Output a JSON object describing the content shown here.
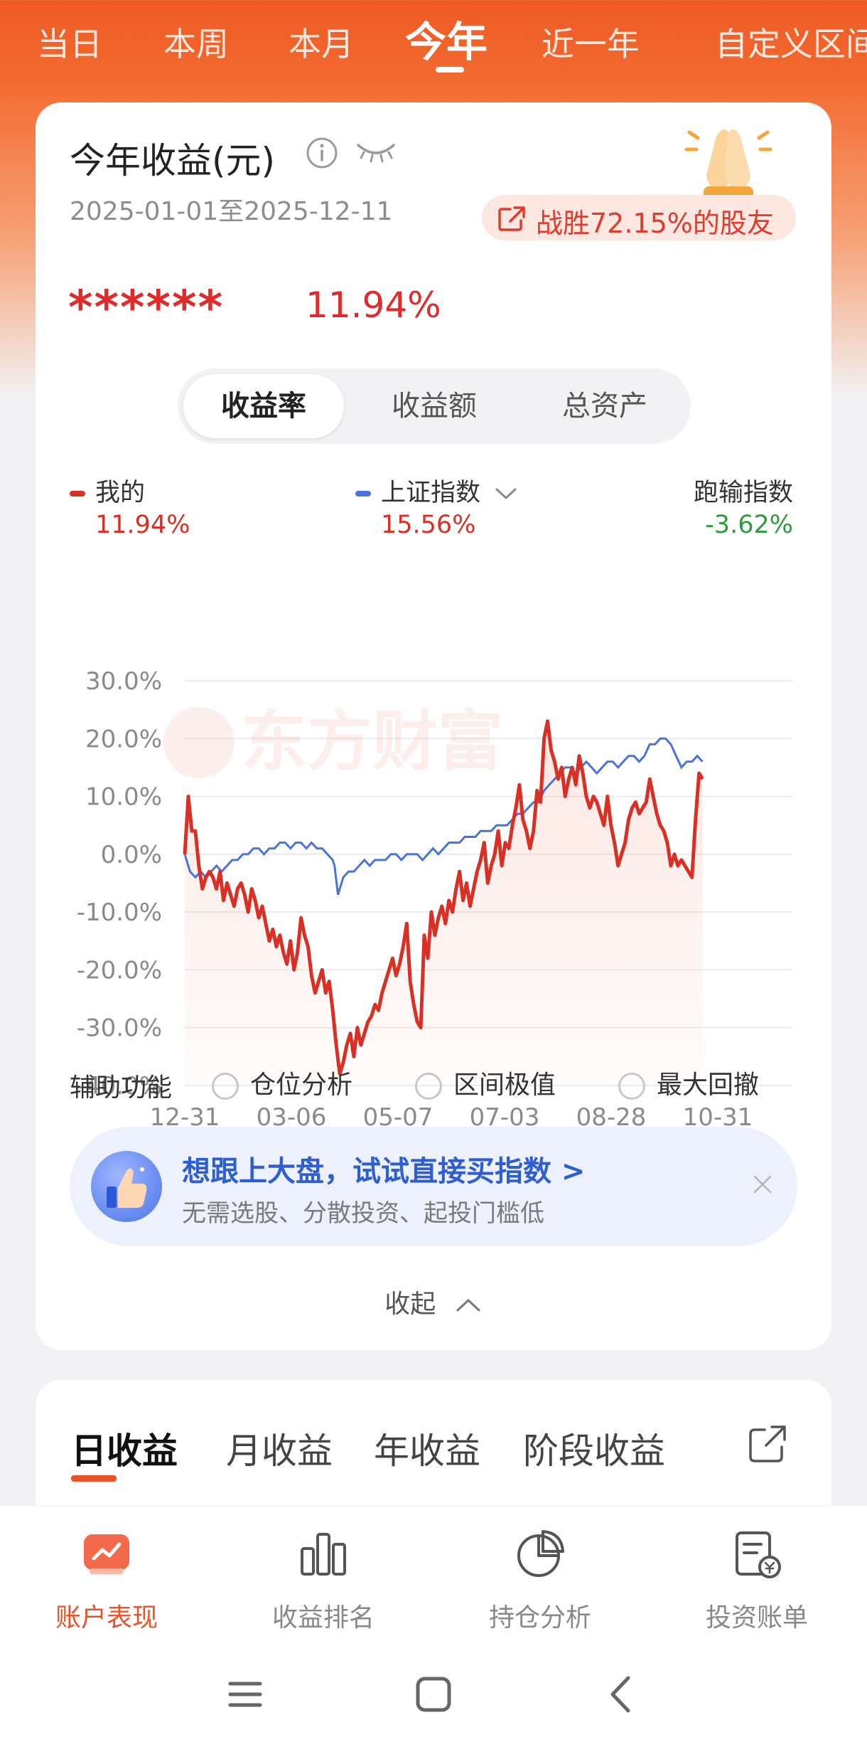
{
  "period_tabs": [
    {
      "label": "当日"
    },
    {
      "label": "本周"
    },
    {
      "label": "本月"
    },
    {
      "label": "今年"
    },
    {
      "label": "近一年"
    },
    {
      "label": "自定义区间"
    }
  ],
  "summary": {
    "title": "今年收益(元)",
    "date_range": "2025-01-01至2025-12-11",
    "beat_text": "战胜72.15%的股友",
    "masked_amount": "******",
    "return_pct": "11.94%"
  },
  "segments": [
    {
      "label": "收益率"
    },
    {
      "label": "收益额"
    },
    {
      "label": "总资产"
    }
  ],
  "legend": {
    "mine": {
      "name": "我的",
      "value": "11.94%"
    },
    "index": {
      "name": "上证指数",
      "value": "15.56%"
    },
    "diff": {
      "name": "跑输指数",
      "value": "-3.62%"
    }
  },
  "colors": {
    "accent": "#e8532a",
    "mine": "#d93025",
    "index": "#4a73d9",
    "negative": "#2e9b3b"
  },
  "watermark": "东方财富",
  "chart_data": {
    "type": "line",
    "x_ticks": [
      "12-31",
      "03-06",
      "05-07",
      "07-03",
      "08-28",
      "10-31"
    ],
    "y_ticks": [
      "30.0%",
      "20.0%",
      "10.0%",
      "0.0%",
      "-10.0%",
      "-20.0%",
      "-30.0%",
      "-40.0%"
    ],
    "ylim": [
      -40,
      30
    ],
    "x_range": [
      0,
      345
    ],
    "series": [
      {
        "name": "我的",
        "color": "#d93025",
        "points": [
          [
            0,
            0
          ],
          [
            2,
            10
          ],
          [
            4,
            4
          ],
          [
            6,
            4
          ],
          [
            8,
            -2
          ],
          [
            10,
            -6
          ],
          [
            12,
            -4
          ],
          [
            14,
            -3
          ],
          [
            16,
            -4
          ],
          [
            18,
            -6
          ],
          [
            20,
            -3
          ],
          [
            22,
            -8
          ],
          [
            24,
            -5
          ],
          [
            26,
            -7
          ],
          [
            28,
            -9
          ],
          [
            30,
            -6
          ],
          [
            32,
            -5
          ],
          [
            34,
            -7
          ],
          [
            36,
            -10
          ],
          [
            38,
            -6
          ],
          [
            40,
            -8
          ],
          [
            42,
            -11
          ],
          [
            44,
            -9
          ],
          [
            46,
            -12
          ],
          [
            48,
            -15
          ],
          [
            50,
            -13
          ],
          [
            52,
            -16
          ],
          [
            54,
            -14
          ],
          [
            56,
            -17
          ],
          [
            58,
            -19
          ],
          [
            60,
            -15
          ],
          [
            62,
            -20
          ],
          [
            64,
            -17
          ],
          [
            66,
            -11
          ],
          [
            68,
            -14
          ],
          [
            70,
            -16
          ],
          [
            72,
            -21
          ],
          [
            74,
            -24
          ],
          [
            76,
            -22
          ],
          [
            78,
            -20
          ],
          [
            80,
            -24
          ],
          [
            82,
            -22
          ],
          [
            84,
            -27
          ],
          [
            86,
            -33
          ],
          [
            88,
            -38
          ],
          [
            90,
            -36
          ],
          [
            92,
            -33
          ],
          [
            94,
            -31
          ],
          [
            96,
            -35
          ],
          [
            98,
            -30
          ],
          [
            100,
            -33
          ],
          [
            102,
            -31
          ],
          [
            104,
            -29
          ],
          [
            106,
            -28
          ],
          [
            108,
            -26
          ],
          [
            110,
            -27
          ],
          [
            112,
            -24
          ],
          [
            114,
            -22
          ],
          [
            116,
            -20
          ],
          [
            118,
            -18
          ],
          [
            120,
            -21
          ],
          [
            122,
            -19
          ],
          [
            124,
            -16
          ],
          [
            126,
            -12
          ],
          [
            128,
            -22
          ],
          [
            130,
            -26
          ],
          [
            132,
            -29
          ],
          [
            134,
            -30
          ],
          [
            136,
            -14
          ],
          [
            138,
            -18
          ],
          [
            140,
            -10
          ],
          [
            142,
            -14
          ],
          [
            144,
            -11
          ],
          [
            146,
            -9
          ],
          [
            148,
            -12
          ],
          [
            150,
            -8
          ],
          [
            152,
            -10
          ],
          [
            154,
            -6
          ],
          [
            156,
            -3
          ],
          [
            158,
            -8
          ],
          [
            160,
            -5
          ],
          [
            162,
            -9
          ],
          [
            164,
            -6
          ],
          [
            166,
            -3
          ],
          [
            168,
            -1
          ],
          [
            170,
            2
          ],
          [
            172,
            -5
          ],
          [
            174,
            -2
          ],
          [
            176,
            0
          ],
          [
            178,
            4
          ],
          [
            180,
            -2
          ],
          [
            182,
            2
          ],
          [
            184,
            1
          ],
          [
            186,
            5
          ],
          [
            188,
            8
          ],
          [
            190,
            12
          ],
          [
            192,
            6
          ],
          [
            194,
            4
          ],
          [
            196,
            1
          ],
          [
            198,
            4
          ],
          [
            200,
            11
          ],
          [
            202,
            9
          ],
          [
            204,
            20
          ],
          [
            206,
            23
          ],
          [
            208,
            18
          ],
          [
            210,
            16
          ],
          [
            212,
            13
          ],
          [
            214,
            15
          ],
          [
            216,
            10
          ],
          [
            218,
            13
          ],
          [
            220,
            15
          ],
          [
            222,
            12
          ],
          [
            224,
            17
          ],
          [
            226,
            14
          ],
          [
            228,
            10
          ],
          [
            230,
            8
          ],
          [
            232,
            10
          ],
          [
            234,
            9
          ],
          [
            236,
            7
          ],
          [
            238,
            5
          ],
          [
            240,
            10
          ],
          [
            242,
            5
          ],
          [
            244,
            2
          ],
          [
            246,
            -2
          ],
          [
            248,
            0
          ],
          [
            250,
            2
          ],
          [
            252,
            6
          ],
          [
            254,
            8
          ],
          [
            256,
            9
          ],
          [
            258,
            7
          ],
          [
            260,
            8
          ],
          [
            262,
            9
          ],
          [
            264,
            13
          ],
          [
            266,
            10
          ],
          [
            268,
            7
          ],
          [
            270,
            5
          ],
          [
            272,
            4
          ],
          [
            274,
            2
          ],
          [
            276,
            -2
          ],
          [
            278,
            0
          ],
          [
            280,
            -2
          ],
          [
            282,
            -1
          ],
          [
            284,
            -2
          ],
          [
            286,
            -3
          ],
          [
            288,
            -4
          ],
          [
            290,
            6
          ],
          [
            292,
            14
          ],
          [
            294,
            13
          ]
        ]
      },
      {
        "name": "上证指数",
        "color": "#4a73d9",
        "points": [
          [
            0,
            0
          ],
          [
            3,
            -3
          ],
          [
            6,
            -4
          ],
          [
            9,
            -3
          ],
          [
            12,
            -4
          ],
          [
            15,
            -3
          ],
          [
            18,
            -2
          ],
          [
            21,
            -3
          ],
          [
            24,
            -2
          ],
          [
            27,
            -1
          ],
          [
            30,
            -1
          ],
          [
            33,
            0
          ],
          [
            36,
            0
          ],
          [
            39,
            1
          ],
          [
            42,
            1
          ],
          [
            45,
            0
          ],
          [
            48,
            1
          ],
          [
            51,
            1
          ],
          [
            54,
            2
          ],
          [
            57,
            2
          ],
          [
            60,
            1
          ],
          [
            63,
            2
          ],
          [
            66,
            2
          ],
          [
            69,
            1
          ],
          [
            72,
            2
          ],
          [
            75,
            1
          ],
          [
            78,
            1
          ],
          [
            81,
            0
          ],
          [
            84,
            -1
          ],
          [
            85,
            -2
          ],
          [
            87,
            -7
          ],
          [
            90,
            -4
          ],
          [
            93,
            -3
          ],
          [
            96,
            -3
          ],
          [
            99,
            -2
          ],
          [
            102,
            -1
          ],
          [
            105,
            -2
          ],
          [
            108,
            -1
          ],
          [
            111,
            -1
          ],
          [
            114,
            -1
          ],
          [
            117,
            0
          ],
          [
            120,
            0
          ],
          [
            123,
            -1
          ],
          [
            126,
            0
          ],
          [
            129,
            0
          ],
          [
            132,
            0
          ],
          [
            135,
            -1
          ],
          [
            138,
            0
          ],
          [
            141,
            1
          ],
          [
            144,
            0
          ],
          [
            147,
            1
          ],
          [
            150,
            2
          ],
          [
            153,
            2
          ],
          [
            156,
            2
          ],
          [
            159,
            3
          ],
          [
            162,
            3
          ],
          [
            165,
            3
          ],
          [
            168,
            4
          ],
          [
            171,
            4
          ],
          [
            174,
            4
          ],
          [
            177,
            5
          ],
          [
            180,
            5
          ],
          [
            183,
            5
          ],
          [
            186,
            6
          ],
          [
            189,
            7
          ],
          [
            192,
            7
          ],
          [
            195,
            8
          ],
          [
            198,
            9
          ],
          [
            201,
            9
          ],
          [
            204,
            11
          ],
          [
            207,
            12
          ],
          [
            210,
            13
          ],
          [
            213,
            14
          ],
          [
            216,
            15
          ],
          [
            219,
            15
          ],
          [
            222,
            14
          ],
          [
            225,
            15
          ],
          [
            228,
            16
          ],
          [
            231,
            15
          ],
          [
            234,
            14
          ],
          [
            237,
            15
          ],
          [
            240,
            16
          ],
          [
            243,
            16
          ],
          [
            246,
            15
          ],
          [
            249,
            16
          ],
          [
            252,
            17
          ],
          [
            255,
            17
          ],
          [
            258,
            16
          ],
          [
            261,
            17
          ],
          [
            264,
            19
          ],
          [
            267,
            19
          ],
          [
            270,
            20
          ],
          [
            273,
            20
          ],
          [
            276,
            19
          ],
          [
            279,
            17
          ],
          [
            282,
            15
          ],
          [
            285,
            16
          ],
          [
            288,
            16
          ],
          [
            291,
            17
          ],
          [
            294,
            16
          ]
        ]
      }
    ]
  },
  "aux": {
    "label": "辅助功能",
    "options": [
      {
        "label": "仓位分析"
      },
      {
        "label": "区间极值"
      },
      {
        "label": "最大回撤"
      }
    ]
  },
  "promo": {
    "title": "想跟上大盘，试试直接买指数 >",
    "subtitle": "无需选股、分散投资、起投门槛低"
  },
  "collapse_label": "收起",
  "income_tabs": [
    {
      "label": "日收益"
    },
    {
      "label": "月收益"
    },
    {
      "label": "年收益"
    },
    {
      "label": "阶段收益"
    }
  ],
  "bottom_nav": [
    {
      "label": "账户表现",
      "icon": "trend-icon"
    },
    {
      "label": "收益排名",
      "icon": "bar-chart-icon"
    },
    {
      "label": "持仓分析",
      "icon": "pie-chart-icon"
    },
    {
      "label": "投资账单",
      "icon": "bill-icon"
    }
  ]
}
